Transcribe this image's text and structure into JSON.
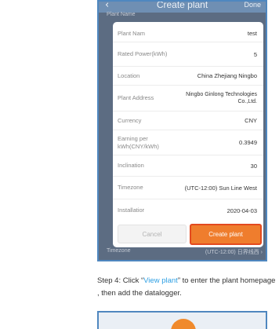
{
  "nav": {
    "back_icon": "‹",
    "title": "Create plant",
    "done": "Done"
  },
  "background": {
    "first_label": "Plant Name",
    "last_label": "Timezone",
    "last_value": "(UTC-12:00) 日界线西",
    "last_chevron": "›"
  },
  "dialog": {
    "rows": [
      {
        "label": "Plant Nam",
        "value": "test"
      },
      {
        "label": "Rated Power(kWh)",
        "value": "5"
      },
      {
        "label": "Location",
        "value": "China Zhejiang Ningbo"
      },
      {
        "label": "Plant Address",
        "value": "Ningbo Ginlong Technologies Co.,Ltd."
      },
      {
        "label": "Currency",
        "value": "CNY"
      },
      {
        "label": "Earning per kWh(CNY/kWh)",
        "value": "0.3949"
      },
      {
        "label": "Inclination",
        "value": "30"
      },
      {
        "label": "Timezone",
        "value": "(UTC-12:00) Sun Line West"
      },
      {
        "label": "Installatior",
        "value": "2020-04-03"
      }
    ],
    "cancel_label": "Cancel",
    "create_label": "Create plant"
  },
  "instruction": {
    "prefix": "Step 4: Click “",
    "link": "View plant",
    "suffix": "” to enter the plant homepage , then add the datalogger."
  },
  "colors": {
    "accent": "#ef7d2d",
    "highlight": "#e34a1f",
    "link": "#2d9fe3",
    "frame": "#4f87bf"
  }
}
